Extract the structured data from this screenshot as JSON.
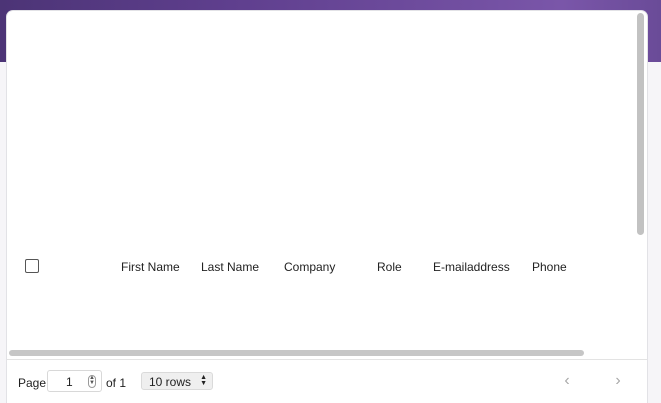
{
  "table": {
    "columns": [
      "First Name",
      "Last Name",
      "Company",
      "Role",
      "E-mailaddress",
      "Phone"
    ]
  },
  "pagination": {
    "page_label": "Page",
    "current_page": "1",
    "of_label": "of 1",
    "rows_per_page": "10 rows",
    "prev_icon": "chevron-left-icon",
    "next_icon": "chevron-right-icon"
  },
  "colors": {
    "banner": "#5f3f8e",
    "card": "#ffffff",
    "scrollbar": "#c2c2c2"
  }
}
